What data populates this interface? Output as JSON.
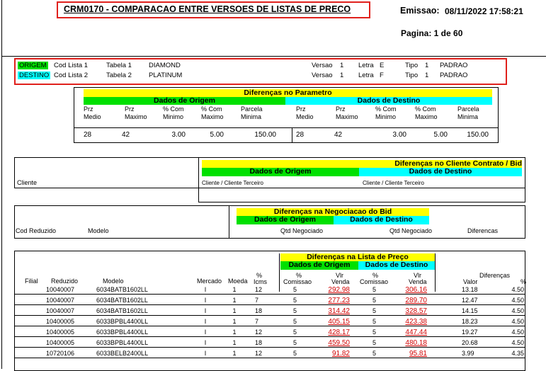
{
  "report": {
    "title": "CRM0170 - COMPARACAO ENTRE VERSOES DE LISTAS DE PRECO",
    "emissao_label": "Emissao:",
    "emissao_value": "08/11/2022 17:58:21",
    "pagina": "Pagina: 1 de 60"
  },
  "header_rows": [
    {
      "tag": "ORIGEM",
      "tag_color": "#00e000",
      "cod_label": "Cod Lista 1",
      "tabela_label": "Tabela 1",
      "tabela_value": "DIAMOND",
      "versao_label": "Versao",
      "versao_value": "1",
      "letra_label": "Letra",
      "letra_value": "E",
      "tipo_label": "Tipo",
      "tipo_value": "1",
      "tipo_name": "PADRAO"
    },
    {
      "tag": "DESTINO",
      "tag_color": "#00ffff",
      "cod_label": "Cod Lista 2",
      "tabela_label": "Tabela 2",
      "tabela_value": "PLATINUM",
      "versao_label": "Versao",
      "versao_value": "1",
      "letra_label": "Letra",
      "letra_value": "F",
      "tipo_label": "Tipo",
      "tipo_value": "1",
      "tipo_name": "PADRAO"
    }
  ],
  "parametro": {
    "title": "Diferenças no Parametro",
    "origem": "Dados de Origem",
    "destino": "Dados de Destino",
    "cols": [
      [
        "Prz",
        "Medio"
      ],
      [
        "Prz",
        "Maximo"
      ],
      [
        "% Com",
        "Minimo"
      ],
      [
        "% Com",
        "Maximo"
      ],
      [
        "Parcela",
        "Minima"
      ],
      [
        "Prz",
        "Medio"
      ],
      [
        "Prz",
        "Maximo"
      ],
      [
        "% Com",
        "Minimo"
      ],
      [
        "% Com",
        "Maximo"
      ],
      [
        "Parcela",
        "Minima"
      ]
    ],
    "values": [
      "28",
      "42",
      "3.00",
      "5.00",
      "150.00",
      "28",
      "42",
      "3.00",
      "5.00",
      "150.00"
    ]
  },
  "cliente": {
    "title": "Diferenças no Cliente Contrato / Bid",
    "origem": "Dados de Origem",
    "destino": "Dados de Destino",
    "col_cliente": "Cliente",
    "col_origem": "Cliente  / Cliente Terceiro",
    "col_destino": "Cliente  / Cliente Terceiro"
  },
  "negociacao": {
    "title": "Diferenças na Negociacao do Bid",
    "origem": "Dados de Origem",
    "destino": "Dados de Destino",
    "col_cod": "Cod Reduzido",
    "col_modelo": "Modelo",
    "col_qtd1": "Qtd Negociado",
    "col_qtd2": "Qtd Negociado",
    "col_dif": "Diferencas"
  },
  "precos": {
    "title": "Diferenças na Lista de Preço",
    "origem": "Dados de Origem",
    "destino": "Dados de Destino",
    "h_filial": "Filial",
    "h_reduzido": "Reduzido",
    "h_modelo": "Modelo",
    "h_mercado": "Mercado",
    "h_moeda": "Moeda",
    "h_pct_top": "%",
    "h_pct_bot": "Icms",
    "h_com1_top": "%",
    "h_com1_bot": "Comissao",
    "h_vlr1_top": "Vlr",
    "h_vlr1_bot": "Venda",
    "h_com2_top": "%",
    "h_com2_bot": "Comissao",
    "h_vlr2_top": "Vlr",
    "h_vlr2_bot": "Venda",
    "h_dif": "Diferenças",
    "h_valor": "Valor",
    "h_pct": "%",
    "rows": [
      {
        "reduzido": "10040007",
        "modelo": "6034BATB1602LL",
        "mercado": "I",
        "moeda": "1",
        "icms": "12",
        "com1": "5",
        "vlr1": "292.98",
        "com2": "5",
        "vlr2": "306.16",
        "valor": "13.18",
        "pct": "4.50"
      },
      {
        "reduzido": "10040007",
        "modelo": "6034BATB1602LL",
        "mercado": "I",
        "moeda": "1",
        "icms": "7",
        "com1": "5",
        "vlr1": "277.23",
        "com2": "5",
        "vlr2": "289.70",
        "valor": "12.47",
        "pct": "4.50"
      },
      {
        "reduzido": "10040007",
        "modelo": "6034BATB1602LL",
        "mercado": "I",
        "moeda": "1",
        "icms": "18",
        "com1": "5",
        "vlr1": "314.42",
        "com2": "5",
        "vlr2": "328.57",
        "valor": "14.15",
        "pct": "4.50"
      },
      {
        "reduzido": "10400005",
        "modelo": "6033BPBL4400LL",
        "mercado": "I",
        "moeda": "1",
        "icms": "7",
        "com1": "5",
        "vlr1": "405.15",
        "com2": "5",
        "vlr2": "423.38",
        "valor": "18.23",
        "pct": "4.50"
      },
      {
        "reduzido": "10400005",
        "modelo": "6033BPBL4400LL",
        "mercado": "I",
        "moeda": "1",
        "icms": "12",
        "com1": "5",
        "vlr1": "428.17",
        "com2": "5",
        "vlr2": "447.44",
        "valor": "19.27",
        "pct": "4.50"
      },
      {
        "reduzido": "10400005",
        "modelo": "6033BPBL4400LL",
        "mercado": "I",
        "moeda": "1",
        "icms": "18",
        "com1": "5",
        "vlr1": "459.50",
        "com2": "5",
        "vlr2": "480.18",
        "valor": "20.68",
        "pct": "4.50"
      },
      {
        "reduzido": "10720106",
        "modelo": "6033BELB2400LL",
        "mercado": "I",
        "moeda": "1",
        "icms": "12",
        "com1": "5",
        "vlr1": "91.82",
        "com2": "5",
        "vlr2": "95.81",
        "valor": "3.99",
        "pct": "4.35"
      }
    ]
  }
}
